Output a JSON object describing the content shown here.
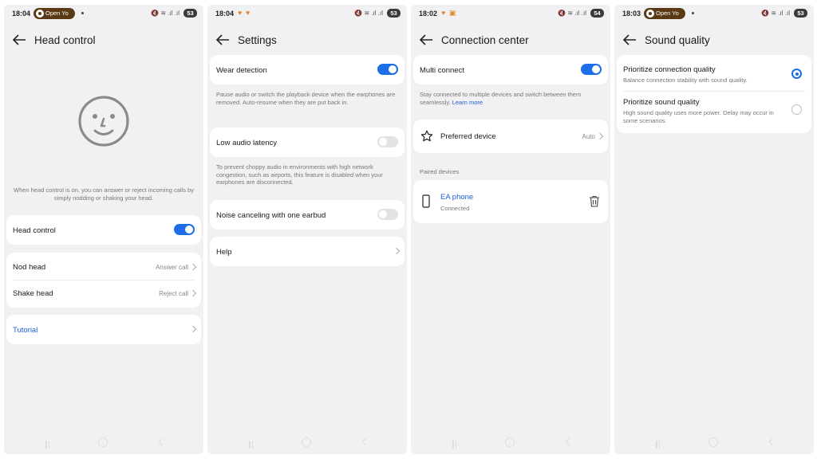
{
  "accent_color": "#1d6fe8",
  "screens": [
    {
      "status": {
        "time": "18:04",
        "pill": "Open Yo",
        "battery": "53"
      },
      "title": "Head control",
      "description": "When head control is on, you can answer or reject incoming calls by simply nodding or shaking your head.",
      "head_control_label": "Head control",
      "head_control_on": true,
      "nod_label": "Nod head",
      "nod_value": "Answer call",
      "shake_label": "Shake head",
      "shake_value": "Reject call",
      "tutorial_label": "Tutorial"
    },
    {
      "status": {
        "time": "18:04",
        "battery": "53"
      },
      "title": "Settings",
      "wear_label": "Wear detection",
      "wear_on": true,
      "wear_desc": "Pause audio or switch the playback device when the earphones are removed. Auto-resume when they are put back in.",
      "latency_label": "Low audio latency",
      "latency_on": false,
      "latency_desc": "To prevent choppy audio in environments with high network congestion, such as airports, this feature is disabled when your earphones are disconnected.",
      "noise_label": "Noise canceling with one earbud",
      "noise_on": false,
      "help_label": "Help"
    },
    {
      "status": {
        "time": "18:02",
        "battery": "54"
      },
      "title": "Connection center",
      "multi_label": "Multi connect",
      "multi_on": true,
      "multi_desc": "Stay connected to multiple devices and switch between them seamlessly.",
      "learn_more": "Learn more",
      "preferred_label": "Preferred device",
      "preferred_value": "Auto",
      "paired_header": "Paired devices",
      "device_name": "EA phone",
      "device_status": "Connected"
    },
    {
      "status": {
        "time": "18:03",
        "pill": "Open Yo",
        "battery": "53"
      },
      "title": "Sound quality",
      "opt1_label": "Prioritize connection quality",
      "opt1_desc": "Balance connection stability with sound quality.",
      "opt1_selected": true,
      "opt2_label": "Prioritize sound quality",
      "opt2_desc": "High sound quality uses more power. Delay may occur in some scenarios.",
      "opt2_selected": false
    }
  ]
}
